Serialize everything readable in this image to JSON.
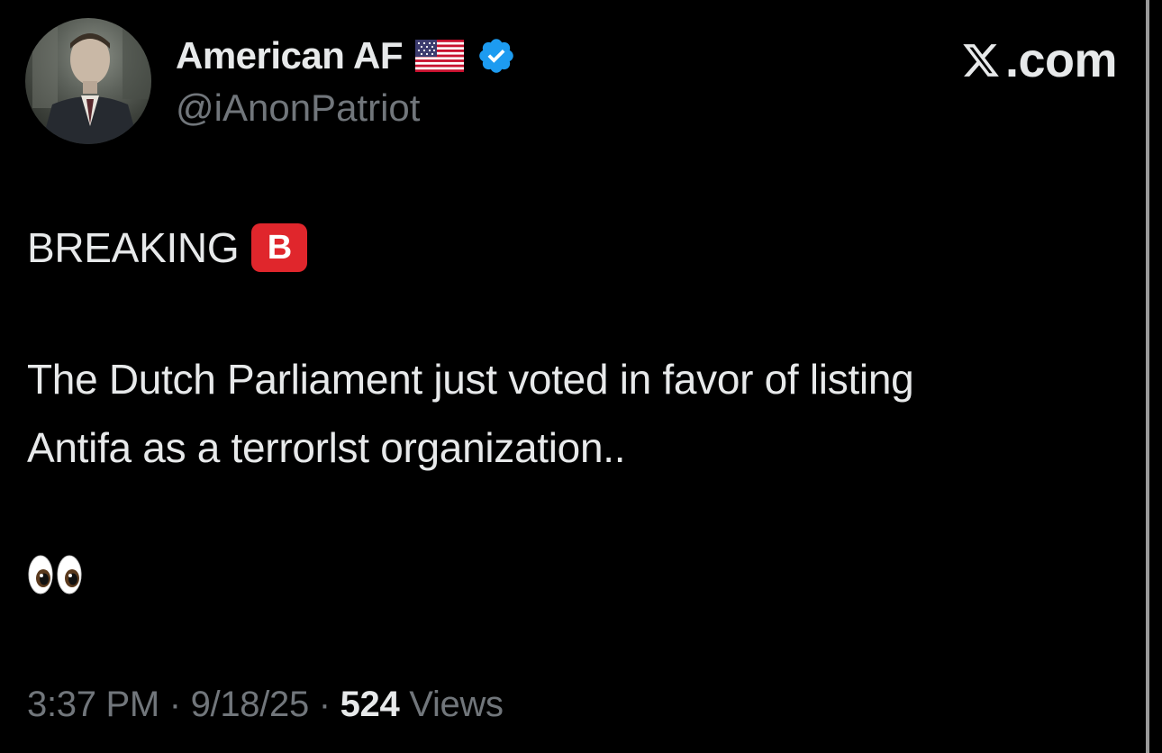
{
  "header": {
    "display_name": "American AF",
    "handle": "@iAnonPatriot",
    "brand_text": ".com"
  },
  "tweet": {
    "line1": "BREAKING",
    "badge_letter": "B",
    "body_line1": "The Dutch Parliament just voted in favor of listing",
    "body_line2": "Antifa as a terrorlst organization.."
  },
  "meta": {
    "time": "3:37 PM",
    "separator": "·",
    "date": "9/18/25",
    "views_count": "524",
    "views_label": "Views"
  },
  "icons": {
    "flag": "us-flag-icon",
    "verified": "verified-badge-icon",
    "brand": "x-logo-icon",
    "eyes": "eyes-emoji-icon"
  },
  "colors": {
    "background": "#000000",
    "text_primary": "#e7e9ea",
    "text_secondary": "#71767b",
    "verified_blue": "#1d9bf0",
    "badge_red": "#e0262c"
  }
}
